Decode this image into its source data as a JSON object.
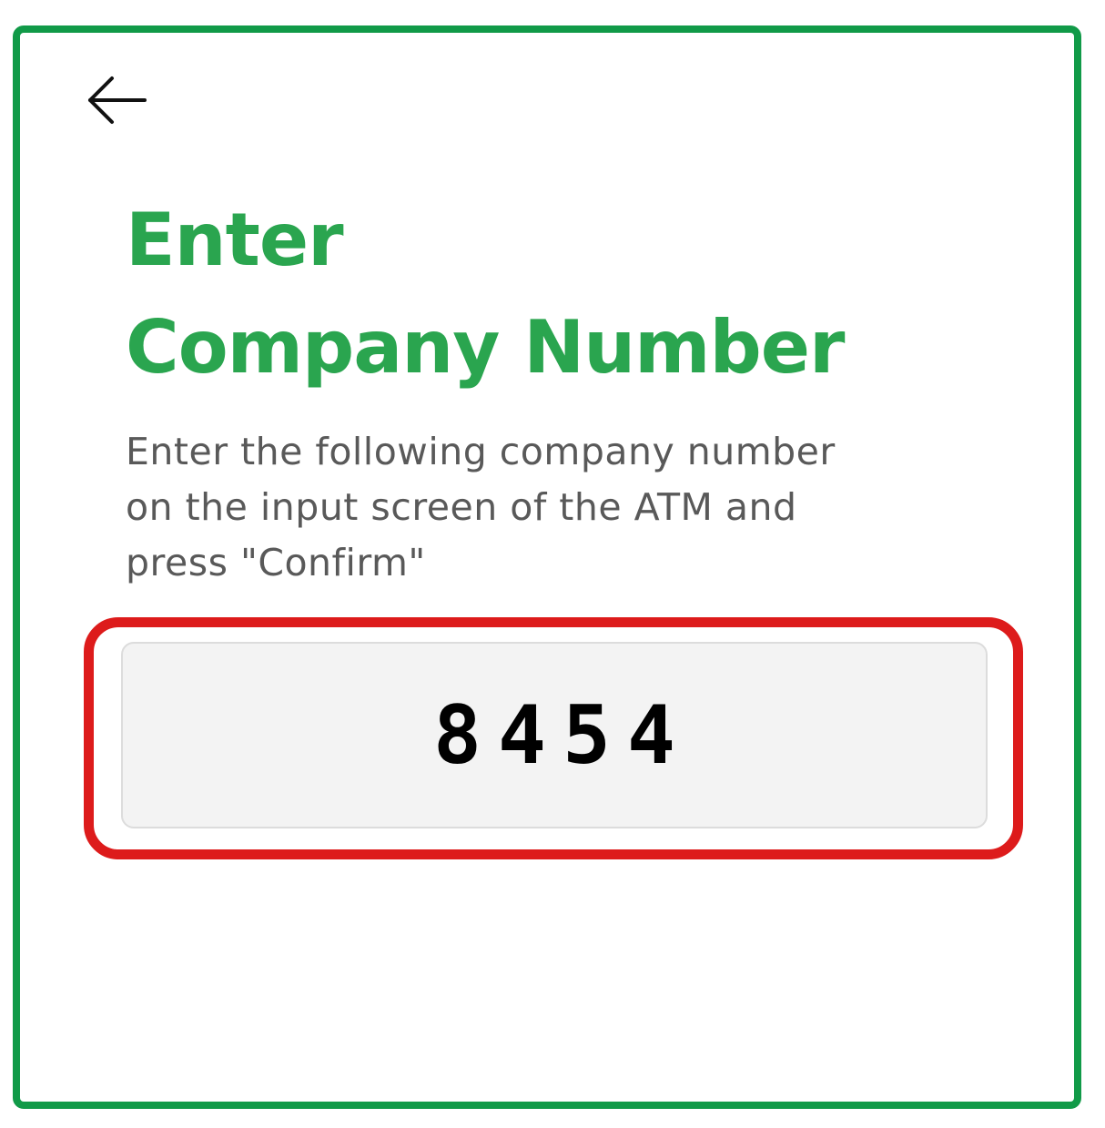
{
  "header": {
    "back_icon": "arrow-left-icon"
  },
  "title": {
    "line1": "Enter",
    "line2": "Company Number"
  },
  "description": {
    "line1": "Enter the following company number",
    "line2": "on the input screen of the ATM and",
    "line3": "press \"Confirm\""
  },
  "company_number": {
    "value": "8454"
  },
  "colors": {
    "frame_border": "#119a48",
    "title": "#2aa54f",
    "highlight_ring": "#dd1b1b",
    "code_box_bg": "#f3f3f3",
    "description_text": "#595959"
  }
}
